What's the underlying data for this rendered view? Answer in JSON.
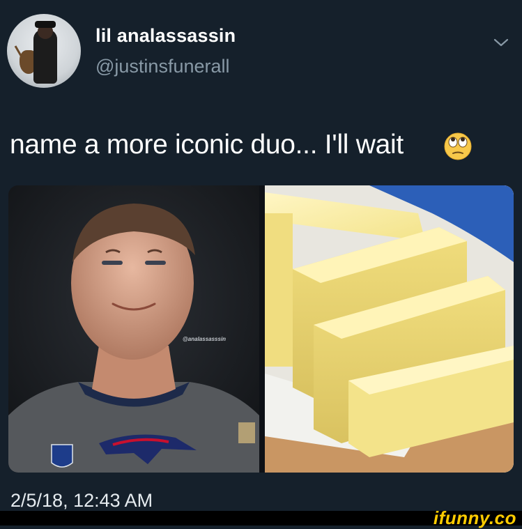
{
  "tweet": {
    "display_name": "lil analassassin",
    "handle": "@justinsfunerall",
    "text": "name a more iconic duo... I'll wait",
    "emoji": "face-with-rolling-eyes",
    "timestamp": "2/5/18, 12:43 AM",
    "menu_icon": "chevron-down-icon"
  },
  "media": {
    "left_photo": "football-player-photo",
    "left_watermark": "@analassasssin",
    "right_photo": "butter-sticks-photo",
    "jersey_badge": "NFL"
  },
  "footer": {
    "brand": "ifunny.co",
    "brand_color": "#ffcc00"
  }
}
